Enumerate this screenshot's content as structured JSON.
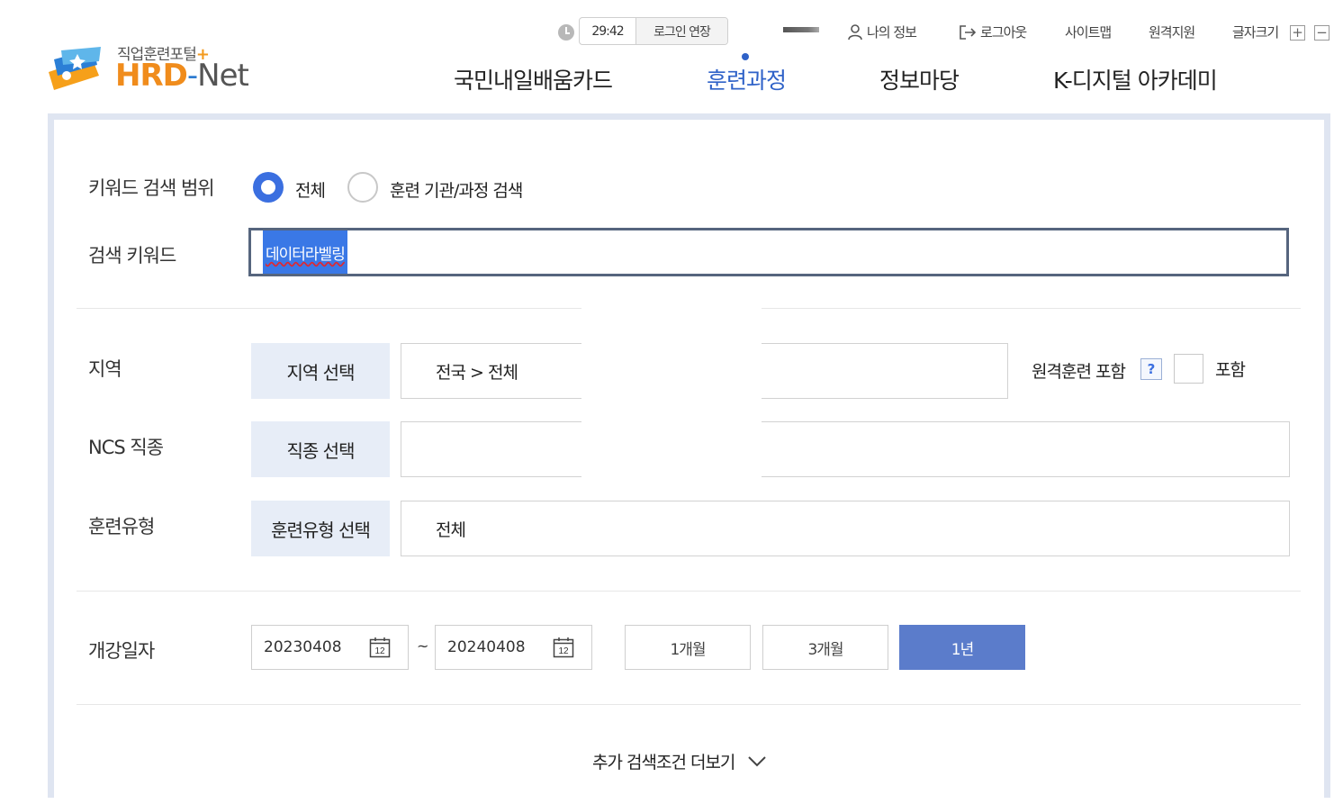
{
  "logo": {
    "subtitle": "직업훈련포털",
    "subtitle_plus": "+",
    "brand_main": "HRD",
    "brand_dash": "-",
    "brand_net": "Net"
  },
  "session": {
    "time": "29:42",
    "extend_label": "로그인 연장"
  },
  "util_nav": {
    "my_info": "나의 정보",
    "logout": "로그아웃",
    "sitemap": "사이트맵",
    "remote_support": "원격지원",
    "font_size": "글자크기",
    "font_plus": "+",
    "font_minus": "−"
  },
  "gnb": [
    {
      "label": "국민내일배움카드",
      "active": false
    },
    {
      "label": "훈련과정",
      "active": true
    },
    {
      "label": "정보마당",
      "active": false
    },
    {
      "label": "K-디지털 아카데미",
      "active": false
    }
  ],
  "search": {
    "scope": {
      "label": "키워드 검색 범위",
      "options": [
        "전체",
        "훈련 기관/과정 검색"
      ],
      "selected": "전체"
    },
    "keyword": {
      "label": "검색 키워드",
      "value": "데이터라벨링"
    },
    "region": {
      "label": "지역",
      "button": "지역 선택",
      "value": "전국 > 전체",
      "remote_label": "원격훈련 포함",
      "help": "?",
      "include_label": "포함",
      "include_checked": false
    },
    "ncs": {
      "label": "NCS 직종",
      "button": "직종 선택",
      "value": ""
    },
    "training_type": {
      "label": "훈련유형",
      "button": "훈련유형 선택",
      "value": "전체"
    },
    "start_date": {
      "label": "개강일자",
      "from": "20230408",
      "to": "20240408",
      "separator": "~",
      "calendar_day": "12",
      "periods": [
        "1개월",
        "3개월",
        "1년"
      ],
      "active_period": "1년"
    },
    "more_label": "추가 검색조건 더보기"
  },
  "colors": {
    "accent": "#2f62c8",
    "radio_on": "#3b6fe0",
    "period_active": "#5b7ccb",
    "select_btn_bg": "#e7edf7",
    "logo_orange": "#f08c1c"
  }
}
